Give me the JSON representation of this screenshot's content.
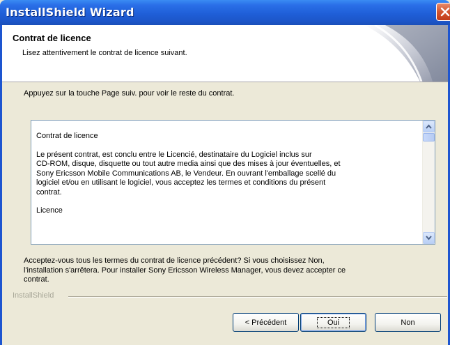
{
  "window": {
    "title": "InstallShield Wizard"
  },
  "header": {
    "title": "Contrat de licence",
    "subtitle": "Lisez attentivement le contrat de licence suivant."
  },
  "instruction": "Appuyez sur la touche Page suiv. pour voir le reste du contrat.",
  "license": {
    "heading": "Contrat de licence",
    "paragraph_lines": [
      "Le présent contrat, est conclu entre le Licencié, destinataire du Logiciel inclus sur",
      "CD-ROM, disque, disquette ou tout autre media  ainsi que des mises à jour éventuelles, et",
      "Sony Ericsson Mobile Communications AB, le Vendeur. En ouvrant l'emballage scellé du",
      "logiciel et/ou en utilisant le logiciel, vous acceptez les termes et conditions du présent",
      "contrat."
    ],
    "section": "Licence"
  },
  "accept_lines": [
    "Acceptez-vous tous les termes du contrat de licence précédent?  Si vous choisissez Non,",
    "l'installation s'arrêtera.  Pour installer Sony Ericsson Wireless Manager, vous devez accepter ce",
    "contrat."
  ],
  "separator_label": "InstallShield",
  "buttons": {
    "back": "< Précédent",
    "yes": "Oui",
    "no": "Non"
  },
  "icons": {
    "close": "close-icon",
    "scroll_up": "scroll-up-arrow-icon",
    "scroll_down": "scroll-down-arrow-icon"
  },
  "colors": {
    "titlebar": "#1f5fd8",
    "close_button": "#d2552f",
    "dialog_background": "#ece9d8"
  }
}
